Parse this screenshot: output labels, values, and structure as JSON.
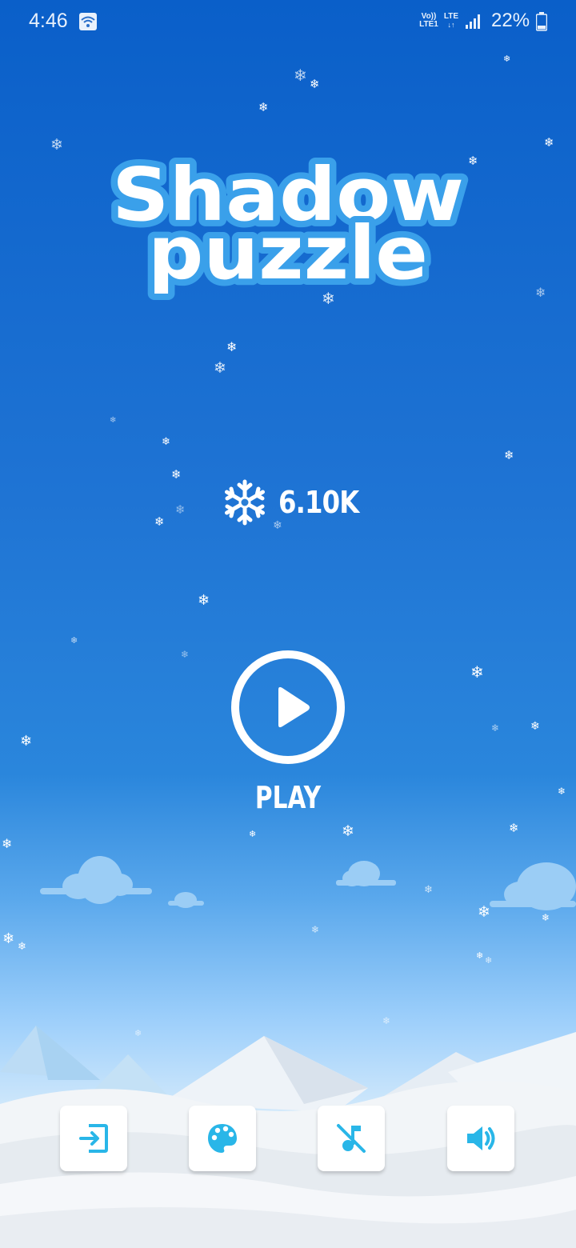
{
  "status_bar": {
    "time": "4:46",
    "volte_line1": "Vo))",
    "volte_line2": "LTE1",
    "lte": "LTE",
    "battery": "22%"
  },
  "game": {
    "title_line1": "Shadow",
    "title_line2": "puzzle",
    "score": "6.10K",
    "play_label": "PLAY"
  },
  "icons": {
    "status": [
      "wifi-icon",
      "signal-icon",
      "battery-icon"
    ],
    "score": "snowflake-icon",
    "play": "play-icon",
    "bottom": [
      "exit-icon",
      "palette-icon",
      "music-off-icon",
      "sound-on-icon"
    ]
  },
  "colors": {
    "sky_top": "#0a5fc9",
    "sky_mid": "#2a86dc",
    "horizon": "#9fd0fb",
    "accent_icon": "#29b6e8",
    "title_outline": "#3aa0ea",
    "white": "#ffffff"
  }
}
